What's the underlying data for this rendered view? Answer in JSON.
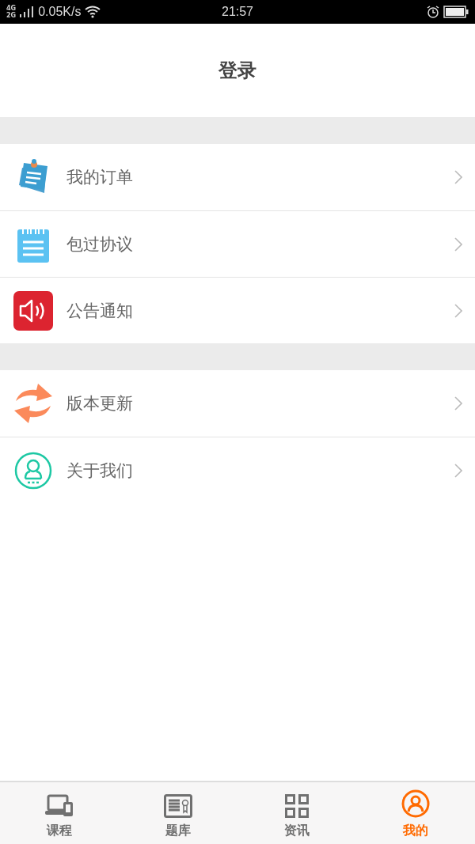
{
  "status_bar": {
    "network_top": "4G",
    "network_bottom": "2G",
    "speed": "0.05K/s",
    "time": "21:57"
  },
  "header": {
    "title": "登录"
  },
  "sections": [
    {
      "items": [
        {
          "label": "我的订单",
          "kind": "order"
        },
        {
          "label": "包过协议",
          "kind": "notepad"
        },
        {
          "label": "公告通知",
          "kind": "speaker"
        }
      ]
    },
    {
      "items": [
        {
          "label": "版本更新",
          "kind": "refresh"
        },
        {
          "label": "关于我们",
          "kind": "person"
        }
      ]
    }
  ],
  "tabs": [
    {
      "label": "课程",
      "kind": "devices",
      "selected": false
    },
    {
      "label": "题库",
      "kind": "certificate",
      "selected": false
    },
    {
      "label": "资讯",
      "kind": "grid",
      "selected": false
    },
    {
      "label": "我的",
      "kind": "user",
      "selected": true
    }
  ]
}
